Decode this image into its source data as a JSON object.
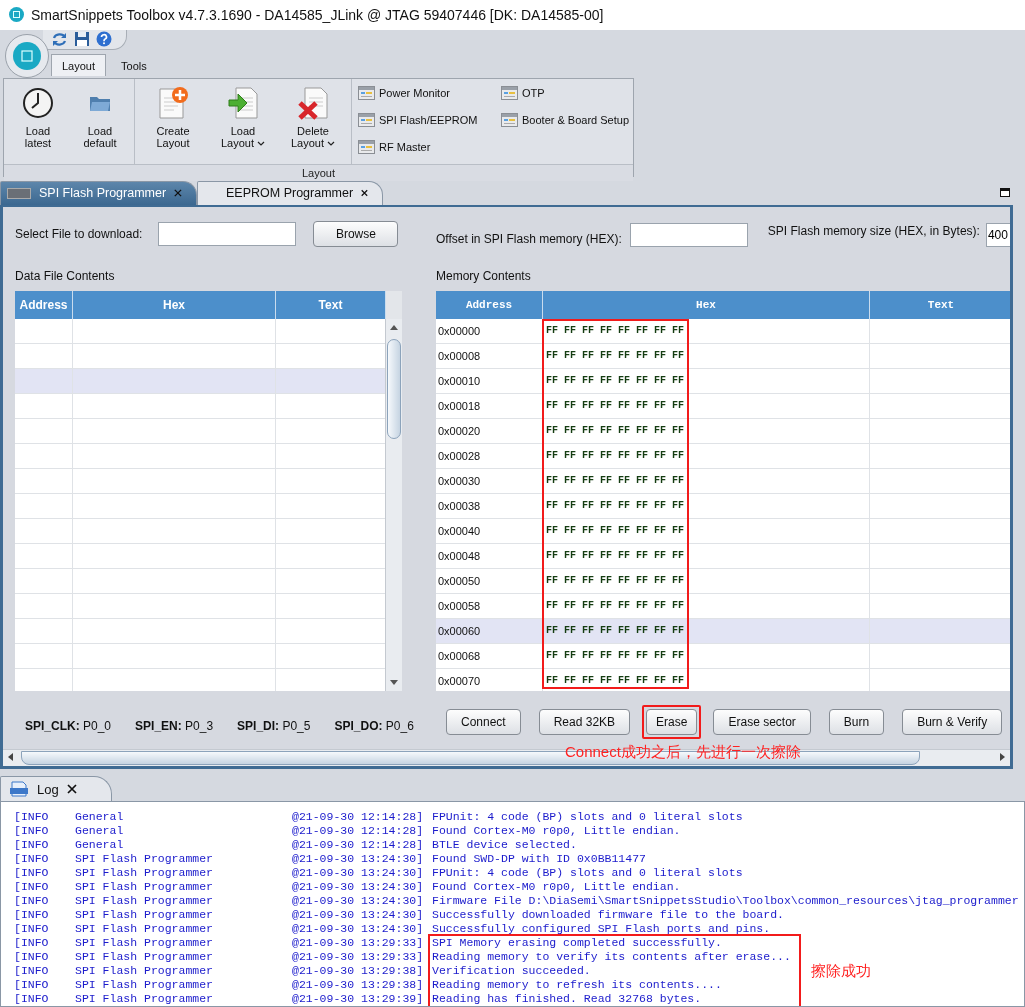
{
  "window": {
    "title": "SmartSnippets Toolbox v4.7.3.1690 - DA14585_JLink @ JTAG 59407446 [DK: DA14585-00]"
  },
  "ribbon": {
    "tabs": [
      {
        "label": "Layout",
        "selected": true
      },
      {
        "label": "Tools",
        "selected": false
      }
    ],
    "groups": [
      {
        "buttons": [
          {
            "label": "Load latest",
            "dropdown": false
          },
          {
            "label": "Load default",
            "dropdown": false
          }
        ]
      },
      {
        "buttons": [
          {
            "label": "Create Layout",
            "dropdown": false
          },
          {
            "label": "Load Layout",
            "dropdown": true
          },
          {
            "label": "Delete Layout",
            "dropdown": true
          }
        ]
      }
    ],
    "launchers": [
      "Power Monitor",
      "SPI Flash/EEPROM",
      "RF Master",
      "OTP",
      "Booter & Board Setup"
    ],
    "footer": "Layout"
  },
  "document_tabs": [
    {
      "label": "SPI Flash Programmer",
      "selected": true
    },
    {
      "label": "EEPROM Programmer",
      "selected": false
    }
  ],
  "spi_panel": {
    "file_label": "Select File to download:",
    "browse_button": "Browse",
    "offset_label": "Offset in SPI Flash memory (HEX):",
    "size_label": "SPI Flash memory size (HEX, in Bytes):",
    "size_value": "400",
    "data_file": {
      "title": "Data File Contents",
      "columns": [
        "Address",
        "Hex",
        "Text"
      ],
      "rows": [
        {
          "selected": false
        },
        {
          "selected": false
        },
        {
          "selected": true
        },
        {
          "selected": false
        },
        {
          "selected": false
        },
        {
          "selected": false
        },
        {
          "selected": false
        },
        {
          "selected": false
        },
        {
          "selected": false
        },
        {
          "selected": false
        },
        {
          "selected": false
        },
        {
          "selected": false
        },
        {
          "selected": false
        },
        {
          "selected": false
        },
        {
          "selected": false
        }
      ]
    },
    "memory": {
      "title": "Memory Contents",
      "columns": [
        "Address",
        "Hex",
        "Text"
      ],
      "hex_highlighted": true,
      "rows": [
        {
          "address": "0x00000",
          "hex": "FF FF FF FF FF FF FF FF",
          "selected": false
        },
        {
          "address": "0x00008",
          "hex": "FF FF FF FF FF FF FF FF",
          "selected": false
        },
        {
          "address": "0x00010",
          "hex": "FF FF FF FF FF FF FF FF",
          "selected": false
        },
        {
          "address": "0x00018",
          "hex": "FF FF FF FF FF FF FF FF",
          "selected": false
        },
        {
          "address": "0x00020",
          "hex": "FF FF FF FF FF FF FF FF",
          "selected": false
        },
        {
          "address": "0x00028",
          "hex": "FF FF FF FF FF FF FF FF",
          "selected": false
        },
        {
          "address": "0x00030",
          "hex": "FF FF FF FF FF FF FF FF",
          "selected": false
        },
        {
          "address": "0x00038",
          "hex": "FF FF FF FF FF FF FF FF",
          "selected": false
        },
        {
          "address": "0x00040",
          "hex": "FF FF FF FF FF FF FF FF",
          "selected": false
        },
        {
          "address": "0x00048",
          "hex": "FF FF FF FF FF FF FF FF",
          "selected": false
        },
        {
          "address": "0x00050",
          "hex": "FF FF FF FF FF FF FF FF",
          "selected": false
        },
        {
          "address": "0x00058",
          "hex": "FF FF FF FF FF FF FF FF",
          "selected": false
        },
        {
          "address": "0x00060",
          "hex": "FF FF FF FF FF FF FF FF",
          "selected": true
        },
        {
          "address": "0x00068",
          "hex": "FF FF FF FF FF FF FF FF",
          "selected": false
        },
        {
          "address": "0x00070",
          "hex": "FF FF FF FF FF FF FF FF",
          "selected": false
        }
      ]
    },
    "pins": [
      "**SPI_CLK:** P0_0",
      "**SPI_EN:** P0_3",
      "**SPI_DI:** P0_5",
      "**SPI_DO:** P0_6"
    ],
    "buttons": [
      {
        "label": "Connect",
        "highlighted": false
      },
      {
        "label": "Read 32KB",
        "highlighted": false
      },
      {
        "label": "Erase",
        "highlighted": true
      },
      {
        "label": "Erase sector",
        "highlighted": false
      },
      {
        "label": "Burn",
        "highlighted": false
      },
      {
        "label": "Burn & Verify",
        "highlighted": false
      }
    ],
    "note": "Connect成功之后，先进行一次擦除"
  },
  "log": {
    "tab": "Log",
    "note": "擦除成功",
    "entries": [
      {
        "level": "[INFO",
        "source": "General",
        "time": "@21-09-30 12:14:28]",
        "message": "FPUnit: 4 code (BP) slots and 0 literal slots",
        "highlighted": false
      },
      {
        "level": "[INFO",
        "source": "General",
        "time": "@21-09-30 12:14:28]",
        "message": "Found Cortex-M0 r0p0, Little endian.",
        "highlighted": false
      },
      {
        "level": "[INFO",
        "source": "General",
        "time": "@21-09-30 12:14:28]",
        "message": "BTLE device selected.",
        "highlighted": false
      },
      {
        "level": "[INFO",
        "source": "SPI Flash Programmer",
        "time": "@21-09-30 13:24:30]",
        "message": "Found SWD-DP with ID 0x0BB11477",
        "highlighted": false
      },
      {
        "level": "[INFO",
        "source": "SPI Flash Programmer",
        "time": "@21-09-30 13:24:30]",
        "message": "FPUnit: 4 code (BP) slots and 0 literal slots",
        "highlighted": false
      },
      {
        "level": "[INFO",
        "source": "SPI Flash Programmer",
        "time": "@21-09-30 13:24:30]",
        "message": "Found Cortex-M0 r0p0, Little endian.",
        "highlighted": false
      },
      {
        "level": "[INFO",
        "source": "SPI Flash Programmer",
        "time": "@21-09-30 13:24:30]",
        "message": "Firmware File D:\\DiaSemi\\SmartSnippetsStudio\\Toolbox\\common_resources\\jtag_programmer",
        "highlighted": false
      },
      {
        "level": "[INFO",
        "source": "SPI Flash Programmer",
        "time": "@21-09-30 13:24:30]",
        "message": "Successfully downloaded firmware file to the board.",
        "highlighted": false
      },
      {
        "level": "[INFO",
        "source": "SPI Flash Programmer",
        "time": "@21-09-30 13:24:30]",
        "message": "Successfully configured SPI Flash ports and pins.",
        "highlighted": false
      },
      {
        "level": "[INFO",
        "source": "SPI Flash Programmer",
        "time": "@21-09-30 13:29:33]",
        "message": "SPI Memory erasing completed successfully.",
        "highlighted": true
      },
      {
        "level": "[INFO",
        "source": "SPI Flash Programmer",
        "time": "@21-09-30 13:29:33]",
        "message": "Reading memory to verify its contents after erase...",
        "highlighted": true
      },
      {
        "level": "[INFO",
        "source": "SPI Flash Programmer",
        "time": "@21-09-30 13:29:38]",
        "message": "Verification succeeded.",
        "highlighted": true
      },
      {
        "level": "[INFO",
        "source": "SPI Flash Programmer",
        "time": "@21-09-30 13:29:38]",
        "message": "Reading memory to refresh its contents....",
        "highlighted": true
      },
      {
        "level": "[INFO",
        "source": "SPI Flash Programmer",
        "time": "@21-09-30 13:29:39]",
        "message": "Reading has finished. Read 32768 bytes.",
        "highlighted": true
      }
    ]
  }
}
